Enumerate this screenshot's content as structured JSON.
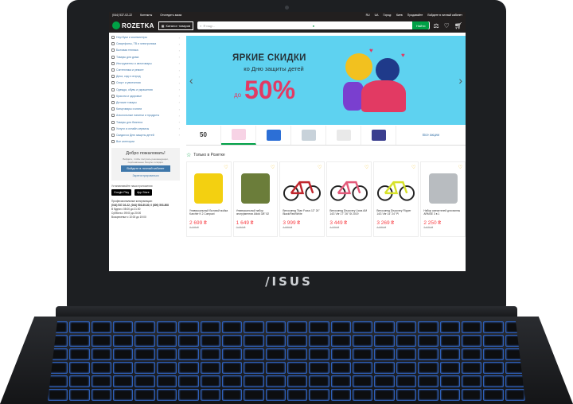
{
  "device": {
    "brand_logo": "/ISUS"
  },
  "topbar": {
    "phone": "(044) 537-02-22",
    "links": [
      "Контакты",
      "Отследить заказ"
    ],
    "languages": [
      "RU",
      "UA"
    ],
    "city_label": "Город:",
    "city": "Киев",
    "sell_link": "Продавайте",
    "account_link": "Войдите в личный кабинет"
  },
  "header": {
    "logo_text": "ROZETKA",
    "catalog_label": "Каталог товаров",
    "search_placeholder": "Я ищу...",
    "search_button": "Найти"
  },
  "sidebar": {
    "categories": [
      "Ноутбуки и компьютеры",
      "Смартфоны, ТВ и электроника",
      "Бытовая техника",
      "Товары для дома",
      "Инструменты и автотовары",
      "Сантехника и ремонт",
      "Дача, сад и огород",
      "Спорт и увлечения",
      "Одежда, обувь и украшения",
      "Красота и здоровье",
      "Детские товары",
      "Канцтовары и книги",
      "Алкогольные напитки и продукты",
      "Товары для бизнеса",
      "Услуги и онлайн-сервисы",
      "Скидки ко Дню защиты детей",
      "Все категории"
    ],
    "welcome_title": "Добро пожаловать!",
    "welcome_text": "Войдите, чтобы получать рекомендации, персональные бонусы и скидки.",
    "login_button": "Войдите в личный кабинет",
    "register_link": "Зарегистрироваться",
    "apps_title": "Устанавливайте наши приложения",
    "store_google": "Google Play",
    "store_apple": "App Store",
    "phones_title": "Профессиональные консультации:",
    "phones": "(044) 537-02-22, (044) 503-80-80, 0 (800) 503-808",
    "hours": [
      "В будни    с 08:00 до 21:00",
      "Суббота    с 09:00 до 20:00",
      "Воскресенье  с 10:00 до 19:00"
    ]
  },
  "banner": {
    "headline": "ЯРКИЕ СКИДКИ",
    "subline": "ко Дню защиты детей",
    "prefix": "до",
    "percent": "50%"
  },
  "thumbs": {
    "first_label": "50",
    "all_label": "Все акции"
  },
  "section": {
    "title": "Только в Розетке"
  },
  "products": [
    {
      "name": "Универсальный бытовой мойка Karcher K 2 Compact",
      "price": "2 699 ₴",
      "old_price": "3 199 ₴"
    },
    {
      "name": "Универсальный набор инструментов Alloid 3/8\" 82",
      "price": "1 649 ₴",
      "old_price": "2 049 ₴"
    },
    {
      "name": "Велосипед Titan Focus 12\" 24\" Black/Red/White",
      "price": "3 999 ₴",
      "old_price": "4 999 ₴"
    },
    {
      "name": "Велосипед Discovery Liana AM 14G Vbr 17\" 26\" St 2019",
      "price": "3 449 ₴",
      "old_price": "4 329 ₴"
    },
    {
      "name": "Велосипед Discovery Flipper 14G Vbr 14\" 24\" Pl",
      "price": "3 269 ₴",
      "old_price": "4 099 ₴"
    },
    {
      "name": "Набор смесителей для ванны ARMSE 3 в 1",
      "price": "2 250 ₴",
      "old_price": "2 620 ₴"
    }
  ],
  "colors": {
    "brand_green": "#00a046",
    "header_dark": "#221f1f",
    "price_red": "#f84147",
    "link_blue": "#3e77aa",
    "banner_cyan": "#5ed2f0"
  }
}
